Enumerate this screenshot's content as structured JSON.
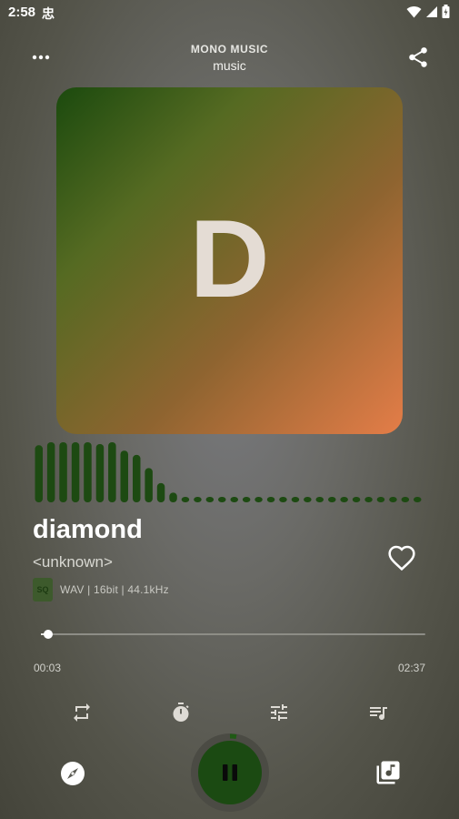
{
  "status_bar": {
    "time": "2:58",
    "carrier_glyph": "忠"
  },
  "header": {
    "title": "MONO MUSIC",
    "subtitle": "music"
  },
  "album": {
    "letter": "D"
  },
  "visualizer": {
    "levels": [
      0.95,
      1.0,
      1.0,
      1.0,
      1.0,
      0.97,
      1.0,
      0.86,
      0.79,
      0.57,
      0.32,
      0.16,
      0.08,
      0.07,
      0.07,
      0.06,
      0.05,
      0.05,
      0.05,
      0.05,
      0.05,
      0.05,
      0.05,
      0.05,
      0.05,
      0.05,
      0.05,
      0.05,
      0.05,
      0.05,
      0.05,
      0.05
    ],
    "color": "#1d4a12"
  },
  "track": {
    "title": "diamond",
    "artist": "<unknown>",
    "quality_badge": "SQ",
    "format": "WAV | 16bit | 44.1kHz"
  },
  "progress": {
    "current": "00:03",
    "total": "02:37",
    "fraction": 0.02
  },
  "colors": {
    "accent": "#1b4a12",
    "art_start": "#1b4a0e",
    "art_end": "#e47d48"
  }
}
